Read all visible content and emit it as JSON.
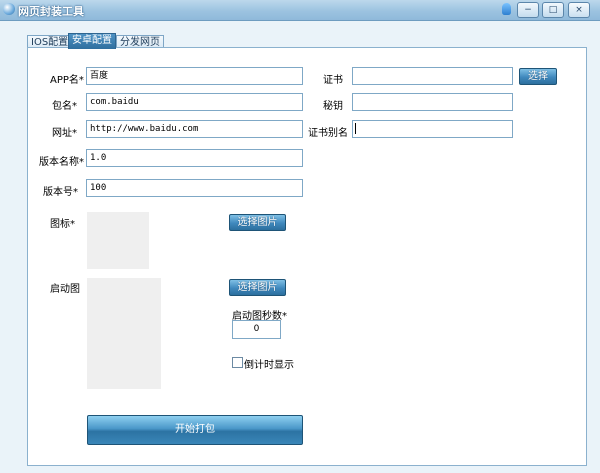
{
  "window": {
    "title": "网页封装工具",
    "minimize": "−",
    "restore": "□",
    "close": "×"
  },
  "tabs": [
    {
      "label": "IOS配置",
      "active": false
    },
    {
      "label": "安卓配置",
      "active": true
    },
    {
      "label": "分发网页",
      "active": false
    }
  ],
  "form": {
    "app_name": {
      "label": "APP名*",
      "value": "百度"
    },
    "package": {
      "label": "包名*",
      "value": "com.baidu"
    },
    "url": {
      "label": "网址*",
      "value": "http://www.baidu.com"
    },
    "version_name": {
      "label": "版本名称*",
      "value": "1.0"
    },
    "version_code": {
      "label": "版本号*",
      "value": "100"
    },
    "icon": {
      "label": "图标*",
      "button": "选择图片"
    },
    "splash": {
      "label": "启动图",
      "button": "选择图片",
      "seconds_label": "启动图秒数*",
      "seconds_value": "0",
      "countdown_label": "倒计时显示",
      "countdown_checked": false
    },
    "cert": {
      "label": "证书",
      "value": "",
      "button": "选择"
    },
    "secret": {
      "label": "秘钥",
      "value": ""
    },
    "cert_alias": {
      "label": "证书别名",
      "value": ""
    },
    "build_button": "开始打包"
  }
}
